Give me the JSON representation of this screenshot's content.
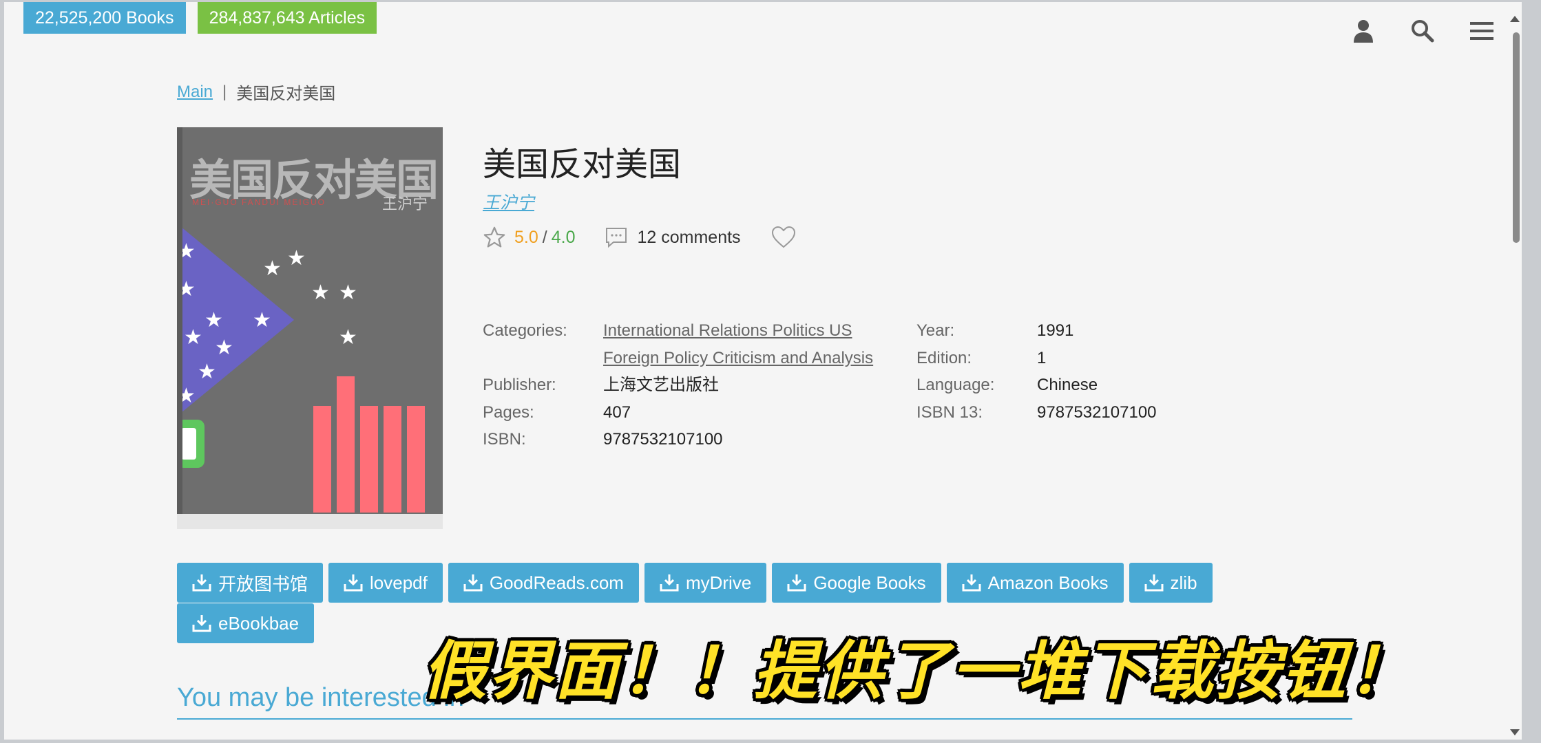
{
  "header": {
    "books_badge": "22,525,200 Books",
    "articles_badge": "284,837,643 Articles",
    "icons": [
      "user-icon",
      "search-icon",
      "menu-icon"
    ]
  },
  "breadcrumb": {
    "main": "Main",
    "separator": "|",
    "current": "美国反对美国"
  },
  "cover": {
    "title_text": "美国反对美国",
    "subtitle_text": "MEI·GUO  FANDUI  MEIGUO",
    "author_text": "王沪宁"
  },
  "book": {
    "title": "美国反对美国",
    "author": "王沪宁",
    "rating_a": "5.0",
    "rating_sep": "/",
    "rating_b": "4.0",
    "comments": "12 comments"
  },
  "props_left": {
    "categories_label": "Categories:",
    "categories_line1": "International Relations Politics US",
    "categories_line2": "Foreign Policy Criticism and Analysis",
    "publisher_label": "Publisher:",
    "publisher": "上海文艺出版社",
    "pages_label": "Pages:",
    "pages": "407",
    "isbn_label": "ISBN:",
    "isbn": "9787532107100"
  },
  "props_right": {
    "year_label": "Year:",
    "year": "1991",
    "edition_label": "Edition:",
    "edition": "1",
    "language_label": "Language:",
    "language": "Chinese",
    "isbn13_label": "ISBN 13:",
    "isbn13": "9787532107100"
  },
  "download_buttons": [
    "开放图书馆",
    "lovepdf",
    "GoodReads.com",
    "myDrive",
    "Google Books",
    "Amazon Books",
    "zlib",
    "eBookbae"
  ],
  "section_heading": "You may be interested in",
  "overlay_caption": "假界面！！提供了一堆下载按钮！",
  "colors": {
    "accent": "#49a9d4",
    "green": "#7ac144",
    "rating_orange": "#f0a020",
    "rating_green": "#4aa84a",
    "caption_yellow": "#ffe227"
  }
}
